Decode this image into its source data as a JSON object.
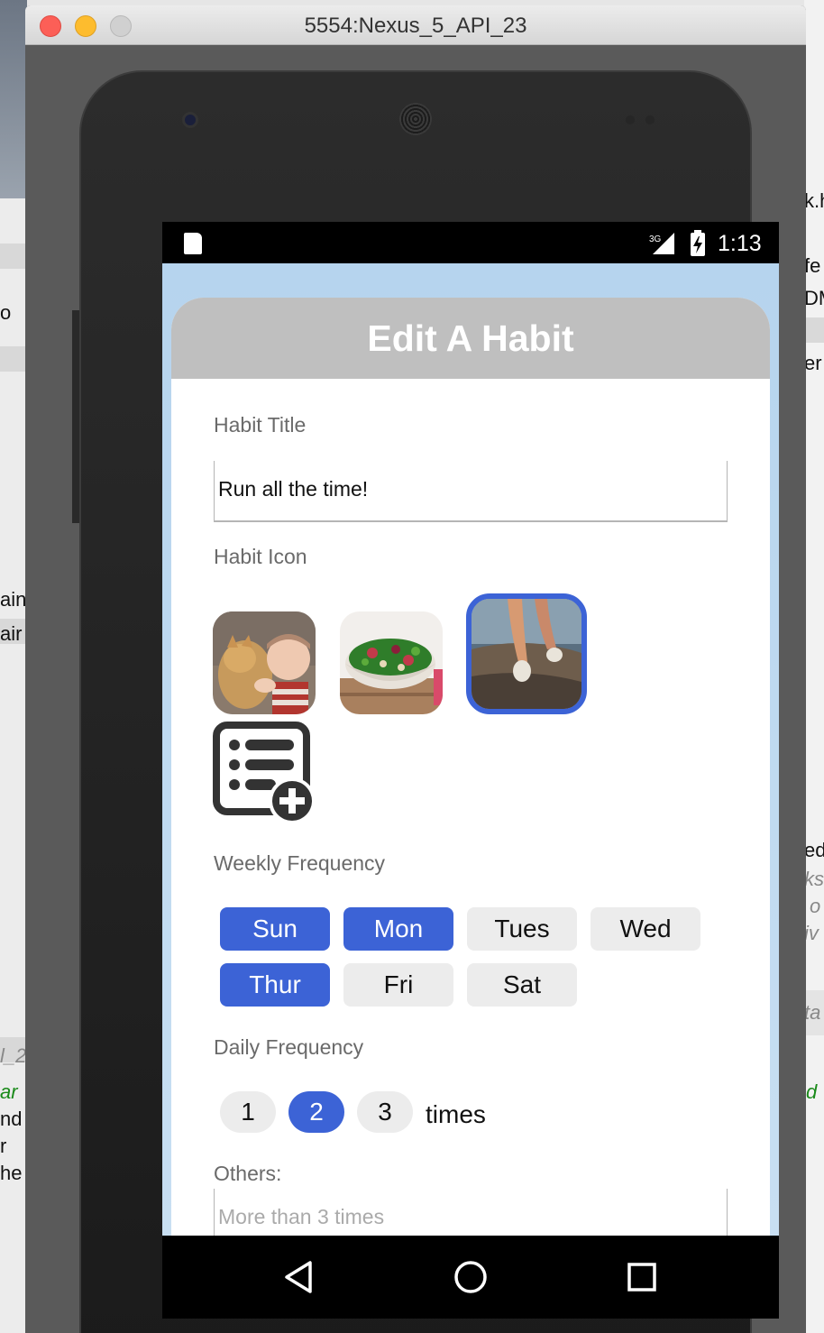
{
  "window": {
    "title": "5554:Nexus_5_API_23"
  },
  "statusbar": {
    "time": "1:13",
    "network": "3G"
  },
  "app": {
    "title": "Edit A Habit",
    "habit_title_label": "Habit Title",
    "habit_title_value": "Run all the time!",
    "habit_icon_label": "Habit Icon",
    "icons": [
      {
        "name": "cat-and-baby-photo",
        "selected": false
      },
      {
        "name": "salad-bowl-photo",
        "selected": false
      },
      {
        "name": "running-legs-photo",
        "selected": true
      },
      {
        "name": "add-list-icon",
        "selected": false
      }
    ],
    "weekly_label": "Weekly Frequency",
    "days": [
      {
        "label": "Sun",
        "on": true
      },
      {
        "label": "Mon",
        "on": true
      },
      {
        "label": "Tues",
        "on": false
      },
      {
        "label": "Wed",
        "on": false
      },
      {
        "label": "Thur",
        "on": true
      },
      {
        "label": "Fri",
        "on": false
      },
      {
        "label": "Sat",
        "on": false
      }
    ],
    "daily_label": "Daily Frequency",
    "daily_options": [
      {
        "label": "1",
        "on": false
      },
      {
        "label": "2",
        "on": true
      },
      {
        "label": "3",
        "on": false
      }
    ],
    "times_label": "times",
    "others_label": "Others:",
    "others_placeholder": "More than 3 times"
  },
  "background_fragments": {
    "left": [
      "o",
      "ain",
      "air",
      "l_2",
      "ar",
      "nd",
      "r",
      "he"
    ],
    "right": [
      "k.h",
      "fe",
      "DM",
      "er",
      "ed",
      "ks",
      "o",
      "iv",
      "ta",
      "d"
    ]
  },
  "colors": {
    "accent": "#3c63d6",
    "header": "#bfbfbf",
    "app_bg": "#b6d4ee"
  }
}
